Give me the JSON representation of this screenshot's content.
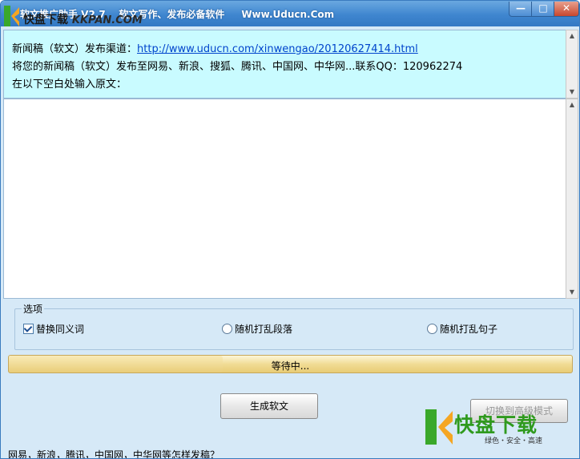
{
  "window": {
    "title": "软文推广助手 V2.7    软文写作、发布必备软件     Www.Uducn.Com",
    "controls": {
      "minimize": "—",
      "maximize": "□",
      "close": "✕"
    }
  },
  "overlay_logo": {
    "cn": "快盘下载",
    "en": "KKPAN.COM"
  },
  "info": {
    "line1_prefix": "新闻稿（软文）发布渠道：",
    "line1_link": "http://www.uducn.com/xinwengao/20120627414.html",
    "line2": "将您的新闻稿（软文）发布至网易、新浪、搜狐、腾讯、中国网、中华网...联系QQ：120962274",
    "line3": "在以下空白处输入原文："
  },
  "editor": {
    "value": ""
  },
  "options": {
    "legend": "选项",
    "synonym": {
      "label": "替换同义词",
      "checked": true
    },
    "shuffle_paragraphs": {
      "label": "随机打乱段落",
      "checked": false
    },
    "shuffle_sentences": {
      "label": "随机打乱句子",
      "checked": false
    }
  },
  "progress": {
    "label": "等待中...",
    "fraction": 0.38
  },
  "buttons": {
    "generate": "生成软文",
    "advanced": "切换到高级模式"
  },
  "bottom_text": "网易，新浪，腾讯，中国网，中华网等怎样发稿？",
  "watermark": {
    "main": "快盘下载",
    "sub": "绿色・安全・高速"
  },
  "colors": {
    "title_bar": "#3f86cf",
    "info_bg": "#c9fbff",
    "window_bg": "#d6e9f7",
    "link": "#0044cc",
    "watermark_green": "#2f9a1e"
  }
}
